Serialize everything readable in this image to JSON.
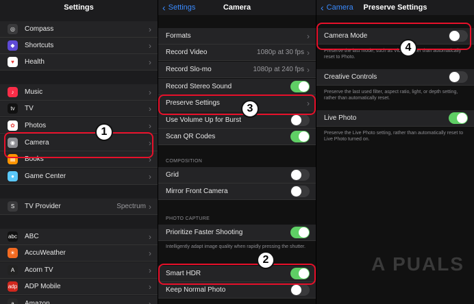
{
  "panel1": {
    "title": "Settings",
    "rows": [
      {
        "label": "Compass",
        "icon": "compass-icon",
        "color": "#3a3a3c",
        "glyph": "◎"
      },
      {
        "label": "Shortcuts",
        "icon": "shortcuts-icon",
        "color": "#5e4ad6",
        "glyph": "◆"
      },
      {
        "label": "Health",
        "icon": "health-icon",
        "color": "#ffffff",
        "glyph": "♥"
      },
      {
        "label": "Music",
        "icon": "music-icon",
        "color": "#fa2d48",
        "glyph": "♪"
      },
      {
        "label": "TV",
        "icon": "tv-icon",
        "color": "#111111",
        "glyph": "tv"
      },
      {
        "label": "Photos",
        "icon": "photos-icon",
        "color": "#ffffff",
        "glyph": "✿"
      },
      {
        "label": "Camera",
        "icon": "camera-icon",
        "color": "#8e8e93",
        "glyph": "◉"
      },
      {
        "label": "Books",
        "icon": "books-icon",
        "color": "#ff9500",
        "glyph": "▤"
      },
      {
        "label": "Game Center",
        "icon": "game-center-icon",
        "color": "#5ac8fa",
        "glyph": "●"
      },
      {
        "label": "TV Provider",
        "value": "Spectrum",
        "icon": "tv-provider-icon",
        "color": "#3a3a3c",
        "glyph": "S"
      },
      {
        "label": "ABC",
        "icon": "abc-icon",
        "color": "#111111",
        "glyph": "abc"
      },
      {
        "label": "AccuWeather",
        "icon": "accuweather-icon",
        "color": "#f26a21",
        "glyph": "☀"
      },
      {
        "label": "Acorn TV",
        "icon": "acorn-tv-icon",
        "color": "#222222",
        "glyph": "A"
      },
      {
        "label": "ADP Mobile",
        "icon": "adp-icon",
        "color": "#d0271d",
        "glyph": "adp"
      },
      {
        "label": "Amazon",
        "icon": "amazon-icon",
        "color": "#2a2a2a",
        "glyph": "a"
      }
    ]
  },
  "panel2": {
    "back": "Settings",
    "title": "Camera",
    "rows": [
      {
        "label": "Formats",
        "chevron": true
      },
      {
        "label": "Record Video",
        "value": "1080p at 30 fps",
        "chevron": true
      },
      {
        "label": "Record Slo-mo",
        "value": "1080p at 240 fps",
        "chevron": true
      },
      {
        "label": "Record Stereo Sound",
        "toggle": true
      },
      {
        "label": "Preserve Settings",
        "chevron": true
      },
      {
        "label": "Use Volume Up for Burst",
        "toggle": false
      },
      {
        "label": "Scan QR Codes",
        "toggle": true
      },
      {
        "label": "Grid",
        "toggle": false
      },
      {
        "label": "Mirror Front Camera",
        "toggle": false
      },
      {
        "label": "Prioritize Faster Shooting",
        "toggle": true
      },
      {
        "label": "Smart HDR",
        "toggle": true
      },
      {
        "label": "Keep Normal Photo",
        "toggle": false
      }
    ],
    "section_composition": "COMPOSITION",
    "section_photo_capture": "PHOTO CAPTURE",
    "note_faster": "Intelligently adapt image quality when rapidly pressing the shutter."
  },
  "panel3": {
    "back": "Camera",
    "title": "Preserve Settings",
    "camera_mode": {
      "label": "Camera Mode",
      "toggle": false
    },
    "camera_mode_note": "Preserve the last mode, such as Video, rather than automatically reset to Photo.",
    "creative": {
      "label": "Creative Controls",
      "toggle": false
    },
    "creative_note": "Preserve the last used filter, aspect ratio, light, or depth setting, rather than automatically reset.",
    "live": {
      "label": "Live Photo",
      "toggle": true
    },
    "live_note": "Preserve the Live Photo setting, rather than automatically reset to Live Photo turned on."
  },
  "badges": [
    "1",
    "2",
    "3",
    "4"
  ],
  "watermark": "A PUALS",
  "colors": {
    "accent": "#3a8bff",
    "toggle_on": "#5fcf65",
    "highlight": "#e8102a"
  }
}
